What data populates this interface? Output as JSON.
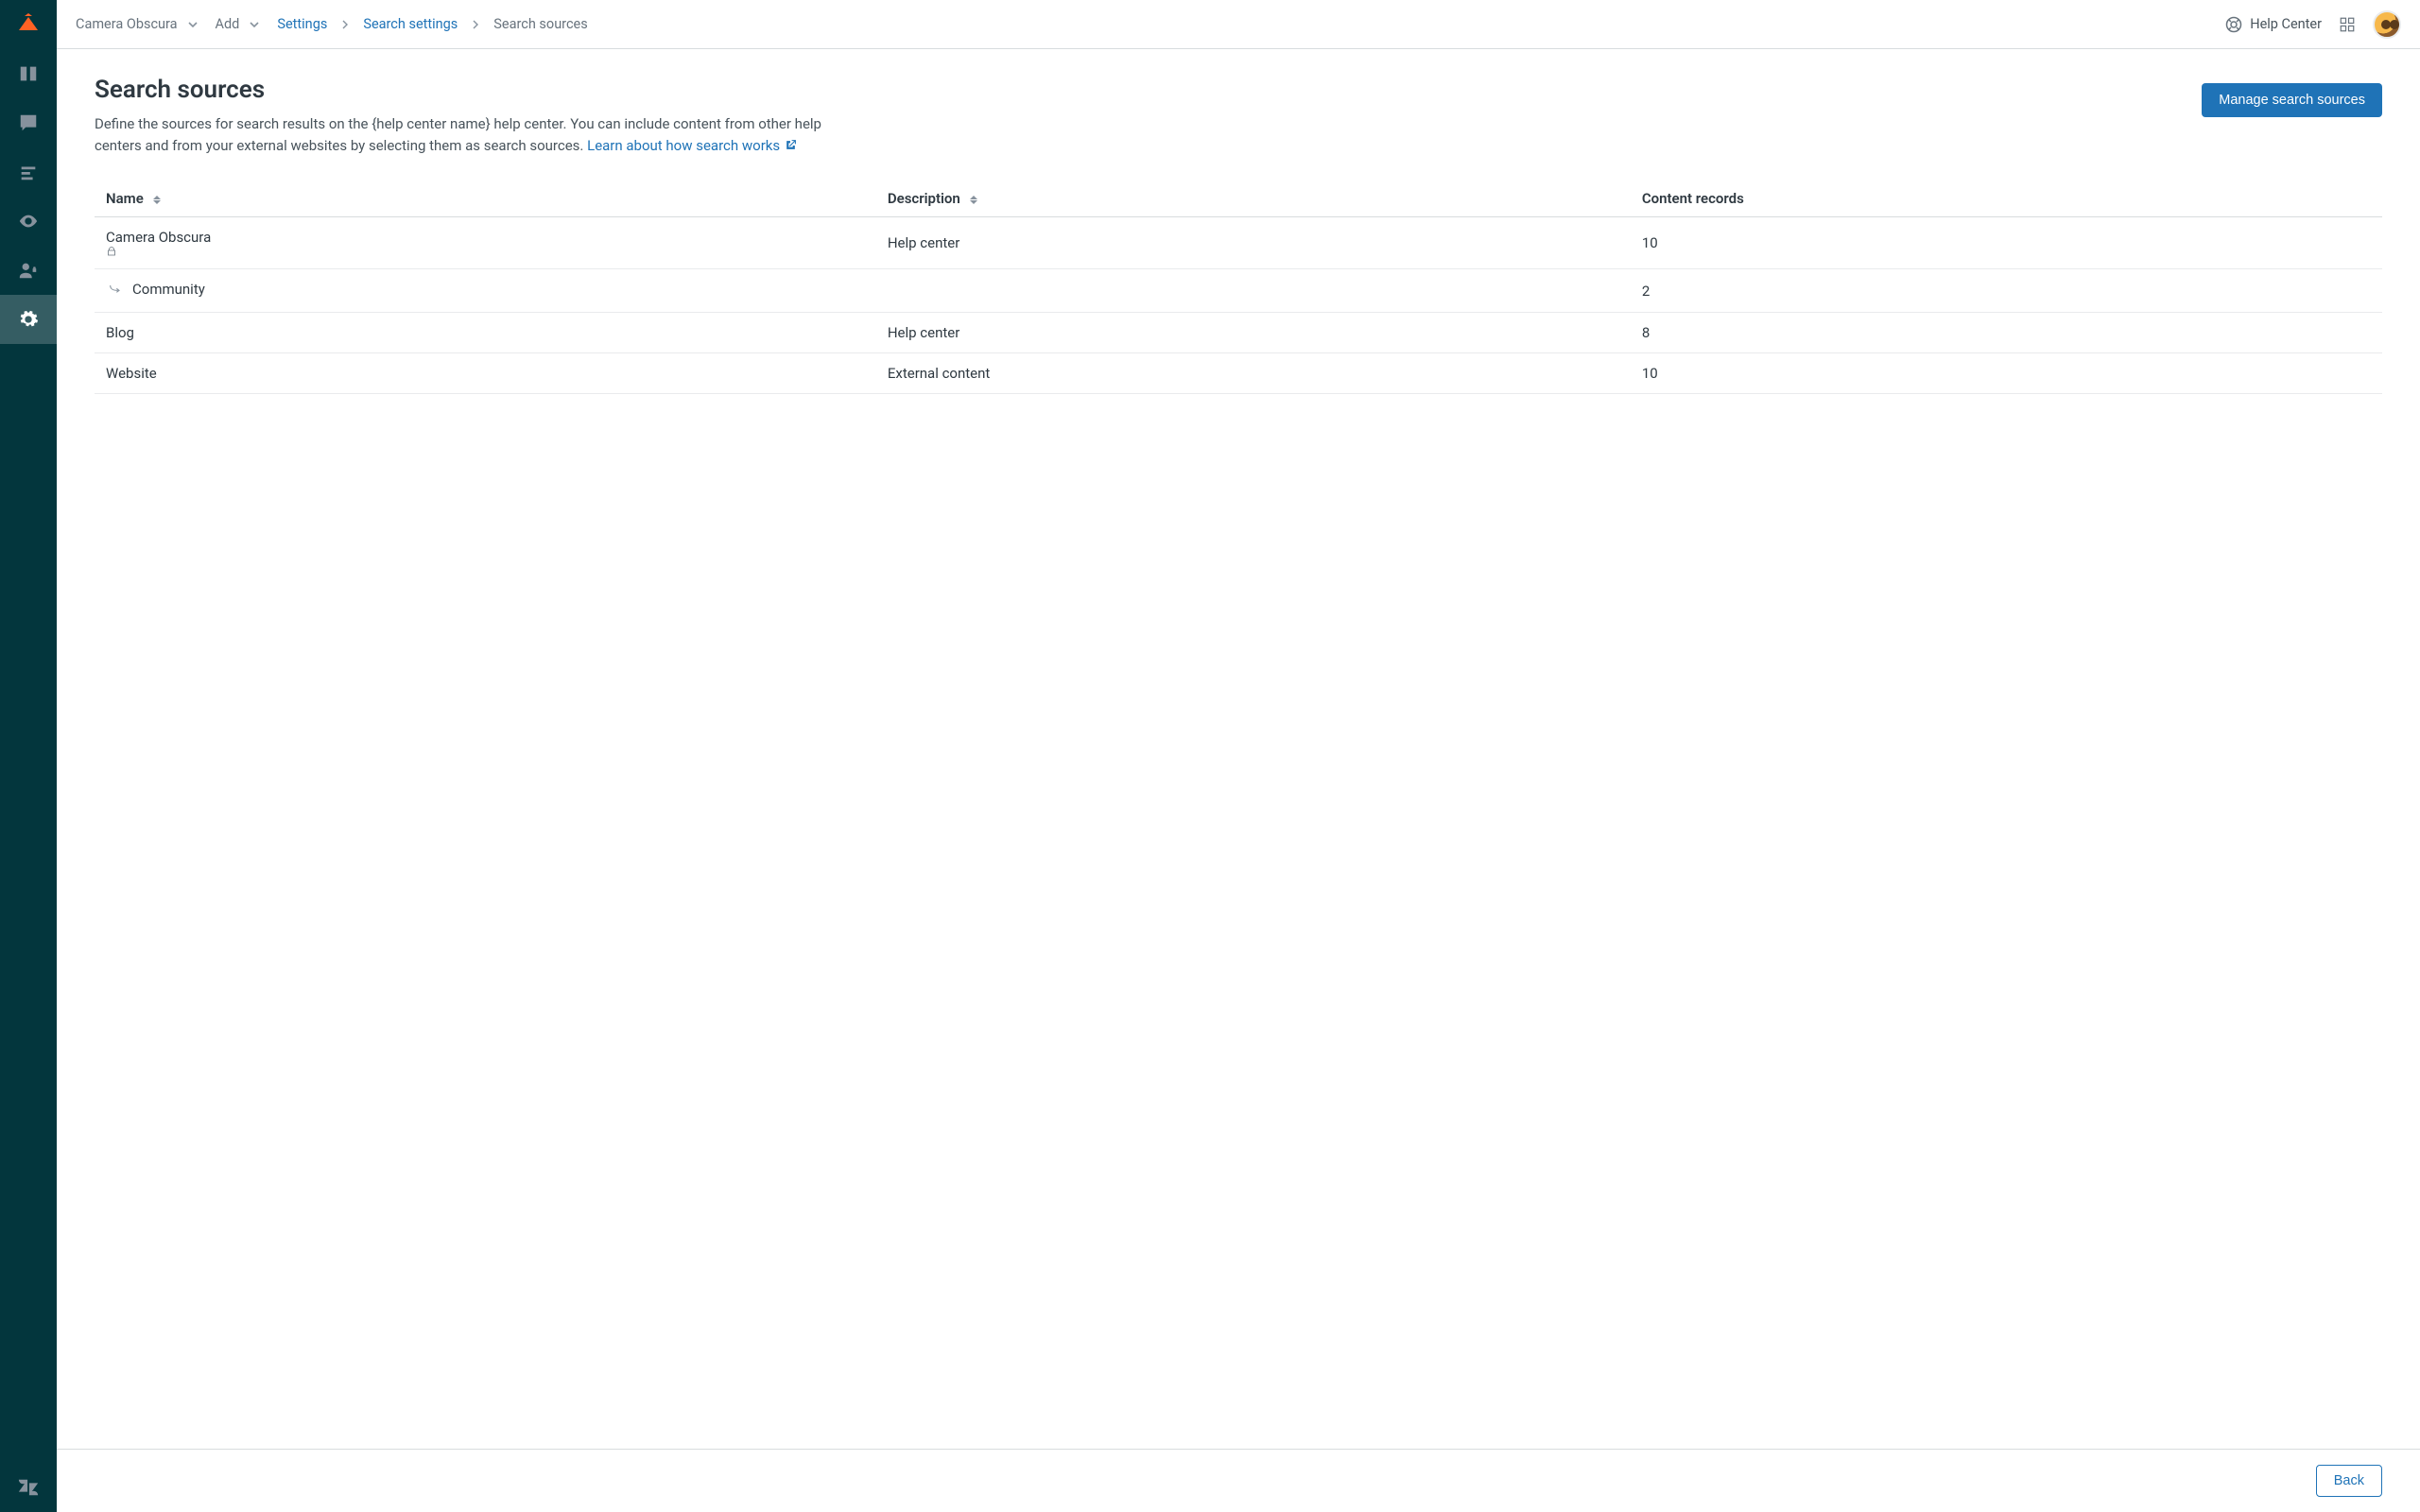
{
  "sidebar": {
    "items": [
      {
        "name": "home"
      },
      {
        "name": "guide"
      },
      {
        "name": "feedback"
      },
      {
        "name": "arrange"
      },
      {
        "name": "preview"
      },
      {
        "name": "users"
      },
      {
        "name": "settings"
      }
    ],
    "active": "settings",
    "footer": {
      "name": "zendesk"
    }
  },
  "topbar": {
    "workspace": "Camera Obscura",
    "add_label": "Add",
    "breadcrumbs": [
      {
        "label": "Settings",
        "link": true
      },
      {
        "label": "Search settings",
        "link": true
      },
      {
        "label": "Search sources",
        "link": false
      }
    ],
    "help_center_label": "Help Center"
  },
  "page": {
    "title": "Search sources",
    "description_pre": "Define the sources for search results on the {help center name} help center. You can include content from other help centers and from your external websites by selecting them as search sources. ",
    "learn_link": "Learn about how search works",
    "manage_button": "Manage search sources"
  },
  "table": {
    "columns": {
      "name": "Name",
      "description": "Description",
      "records": "Content records"
    },
    "rows": [
      {
        "name": "Camera Obscura",
        "locked": true,
        "indent": false,
        "description": "Help center",
        "records": "10"
      },
      {
        "name": "Community",
        "locked": false,
        "indent": true,
        "description": "",
        "records": "2"
      },
      {
        "name": "Blog",
        "locked": false,
        "indent": false,
        "description": "Help center",
        "records": "8"
      },
      {
        "name": "Website",
        "locked": false,
        "indent": false,
        "description": "External content",
        "records": "10"
      }
    ]
  },
  "footer": {
    "back_label": "Back"
  },
  "colors": {
    "accent": "#1f73b7",
    "brand": "#ff6224",
    "sidebar_bg": "#03363d"
  }
}
